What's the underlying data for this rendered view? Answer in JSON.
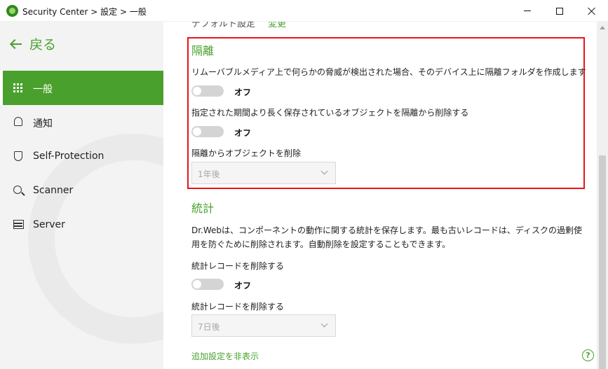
{
  "window": {
    "title": "Security Center > 設定 > 一般",
    "app_icon": "drweb-spider-icon"
  },
  "sidebar": {
    "back_label": "戻る",
    "items": [
      {
        "label": "一般",
        "icon": "grid-icon",
        "active": true
      },
      {
        "label": "通知",
        "icon": "bell-icon",
        "active": false
      },
      {
        "label": "Self-Protection",
        "icon": "shield-icon",
        "active": false
      },
      {
        "label": "Scanner",
        "icon": "search-icon",
        "active": false
      },
      {
        "label": "Server",
        "icon": "server-icon",
        "active": false
      }
    ]
  },
  "content": {
    "cut_off_text": "デフォルト設定",
    "cut_off_link": "変更",
    "quarantine": {
      "title": "隔離",
      "removable_desc": "リムーバブルメディア上で何らかの脅威が検出された場合、そのデバイス上に隔離フォルダを作成します",
      "removable_toggle": "オフ",
      "expire_desc": "指定された期間より長く保存されているオブジェクトを隔離から削除する",
      "expire_toggle": "オフ",
      "delete_label": "隔離からオブジェクトを削除",
      "delete_select": "1年後"
    },
    "stats": {
      "title": "統計",
      "desc_line1": "Dr.Webは、コンポーネントの動作に関する統計を保存します。最も古いレコードは、ディスクの過剰使",
      "desc_line2": "用を防ぐために削除されます。自動削除を設定することもできます。",
      "delete_desc": "統計レコードを削除する",
      "delete_toggle": "オフ",
      "delete_label": "統計レコードを削除する",
      "delete_select": "7日後"
    },
    "hide_advanced_link": "追加設定を非表示",
    "help_icon": "?"
  },
  "colors": {
    "accent": "#4aa02c",
    "highlight_border": "#e8141b",
    "sidebar_bg": "#f3f3f3"
  }
}
